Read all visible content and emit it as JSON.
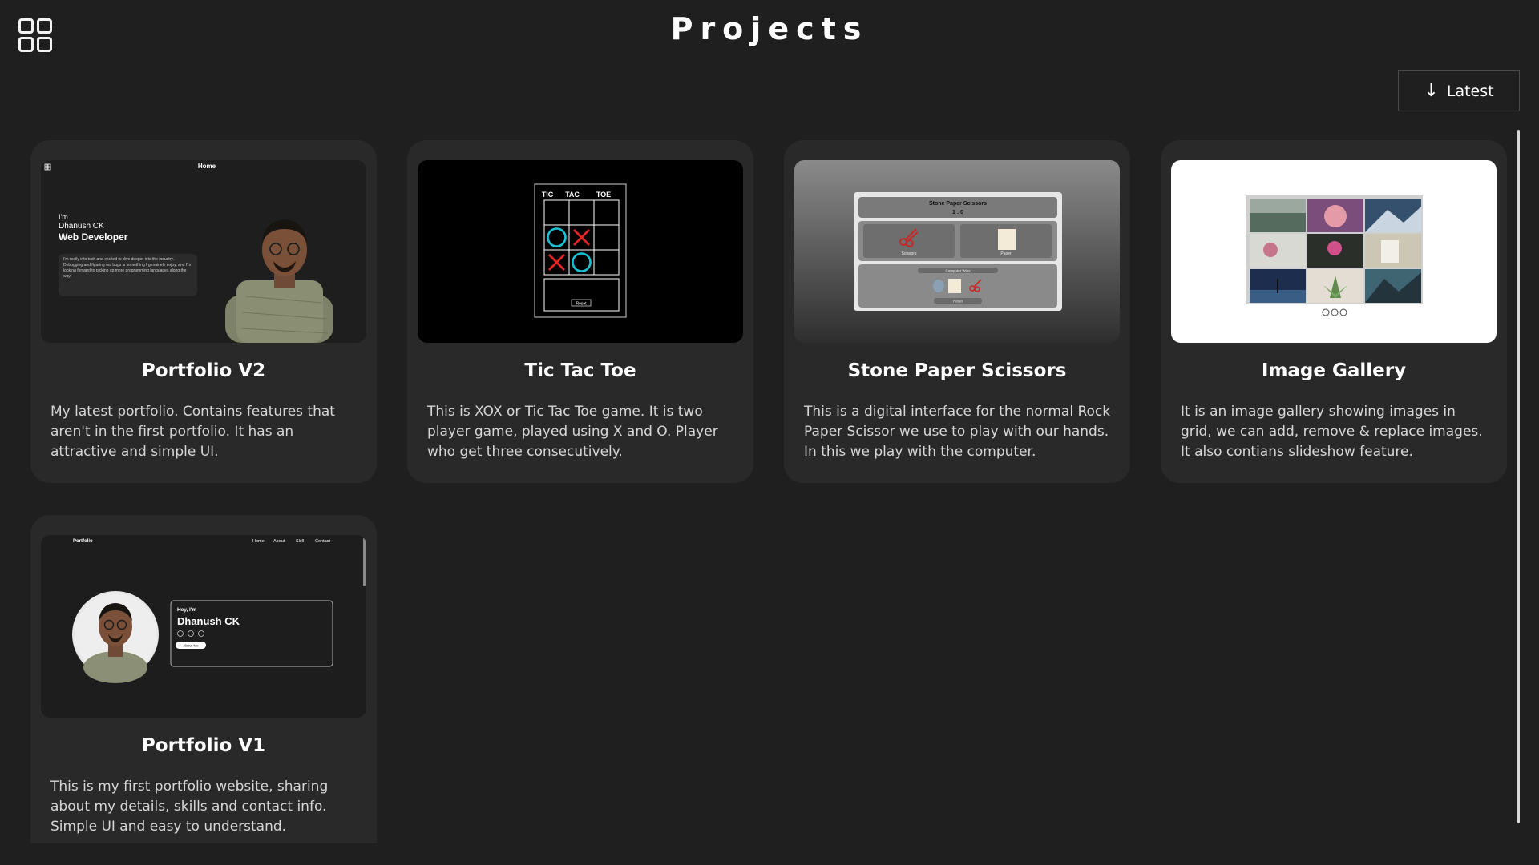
{
  "page": {
    "title": "Projects"
  },
  "sort": {
    "label": "Latest",
    "icon": "arrow-down-icon"
  },
  "menu": {
    "icon": "grid-icon"
  },
  "projects": [
    {
      "title": "Portfolio V2",
      "description": "My latest portfolio. Contains features that aren't in the first portfolio. It has an attractive and simple UI.",
      "thumb": {
        "nav": "Home",
        "intro": "I'm",
        "name": "Dhanush CK",
        "role": "Web Developer",
        "bio": "I'm really into tech and excited to dive deeper into the industry. Debugging and figuring out bugs is something I genuinely enjoy, and I'm looking forward to picking up more programming languages along the way!"
      }
    },
    {
      "title": "Tic Tac Toe",
      "description": "This is XOX or Tic Tac Toe game. It is two player game, played using X and O. Player who get three consecutively.",
      "thumb": {
        "headers": [
          "TIC",
          "TAC",
          "TOE"
        ],
        "reset": "Reset"
      }
    },
    {
      "title": "Stone Paper Scissors",
      "description": "This is a digital interface for the normal Rock Paper Scissor we use to play with our hands. In this we play with the computer.",
      "thumb": {
        "header": "Stone Paper Scissors",
        "score": "1 : 0",
        "choice1": "Scissors",
        "choice2": "Paper",
        "computer": "Computer Wins",
        "reset": "Reset"
      }
    },
    {
      "title": "Image Gallery",
      "description": "It is an image gallery showing images in grid, we can add, remove & replace images. It also contians slideshow feature.",
      "thumb": {}
    },
    {
      "title": "Portfolio V1",
      "description": "This is my first portfolio website, sharing about my details, skills and contact info. Simple UI and easy to understand.",
      "thumb": {
        "brand": "Portfolio",
        "nav": [
          "Home",
          "About",
          "Skill",
          "Contact"
        ],
        "hey": "Hey, I'm",
        "name": "Dhanush  CK",
        "button": "About Me"
      }
    }
  ]
}
